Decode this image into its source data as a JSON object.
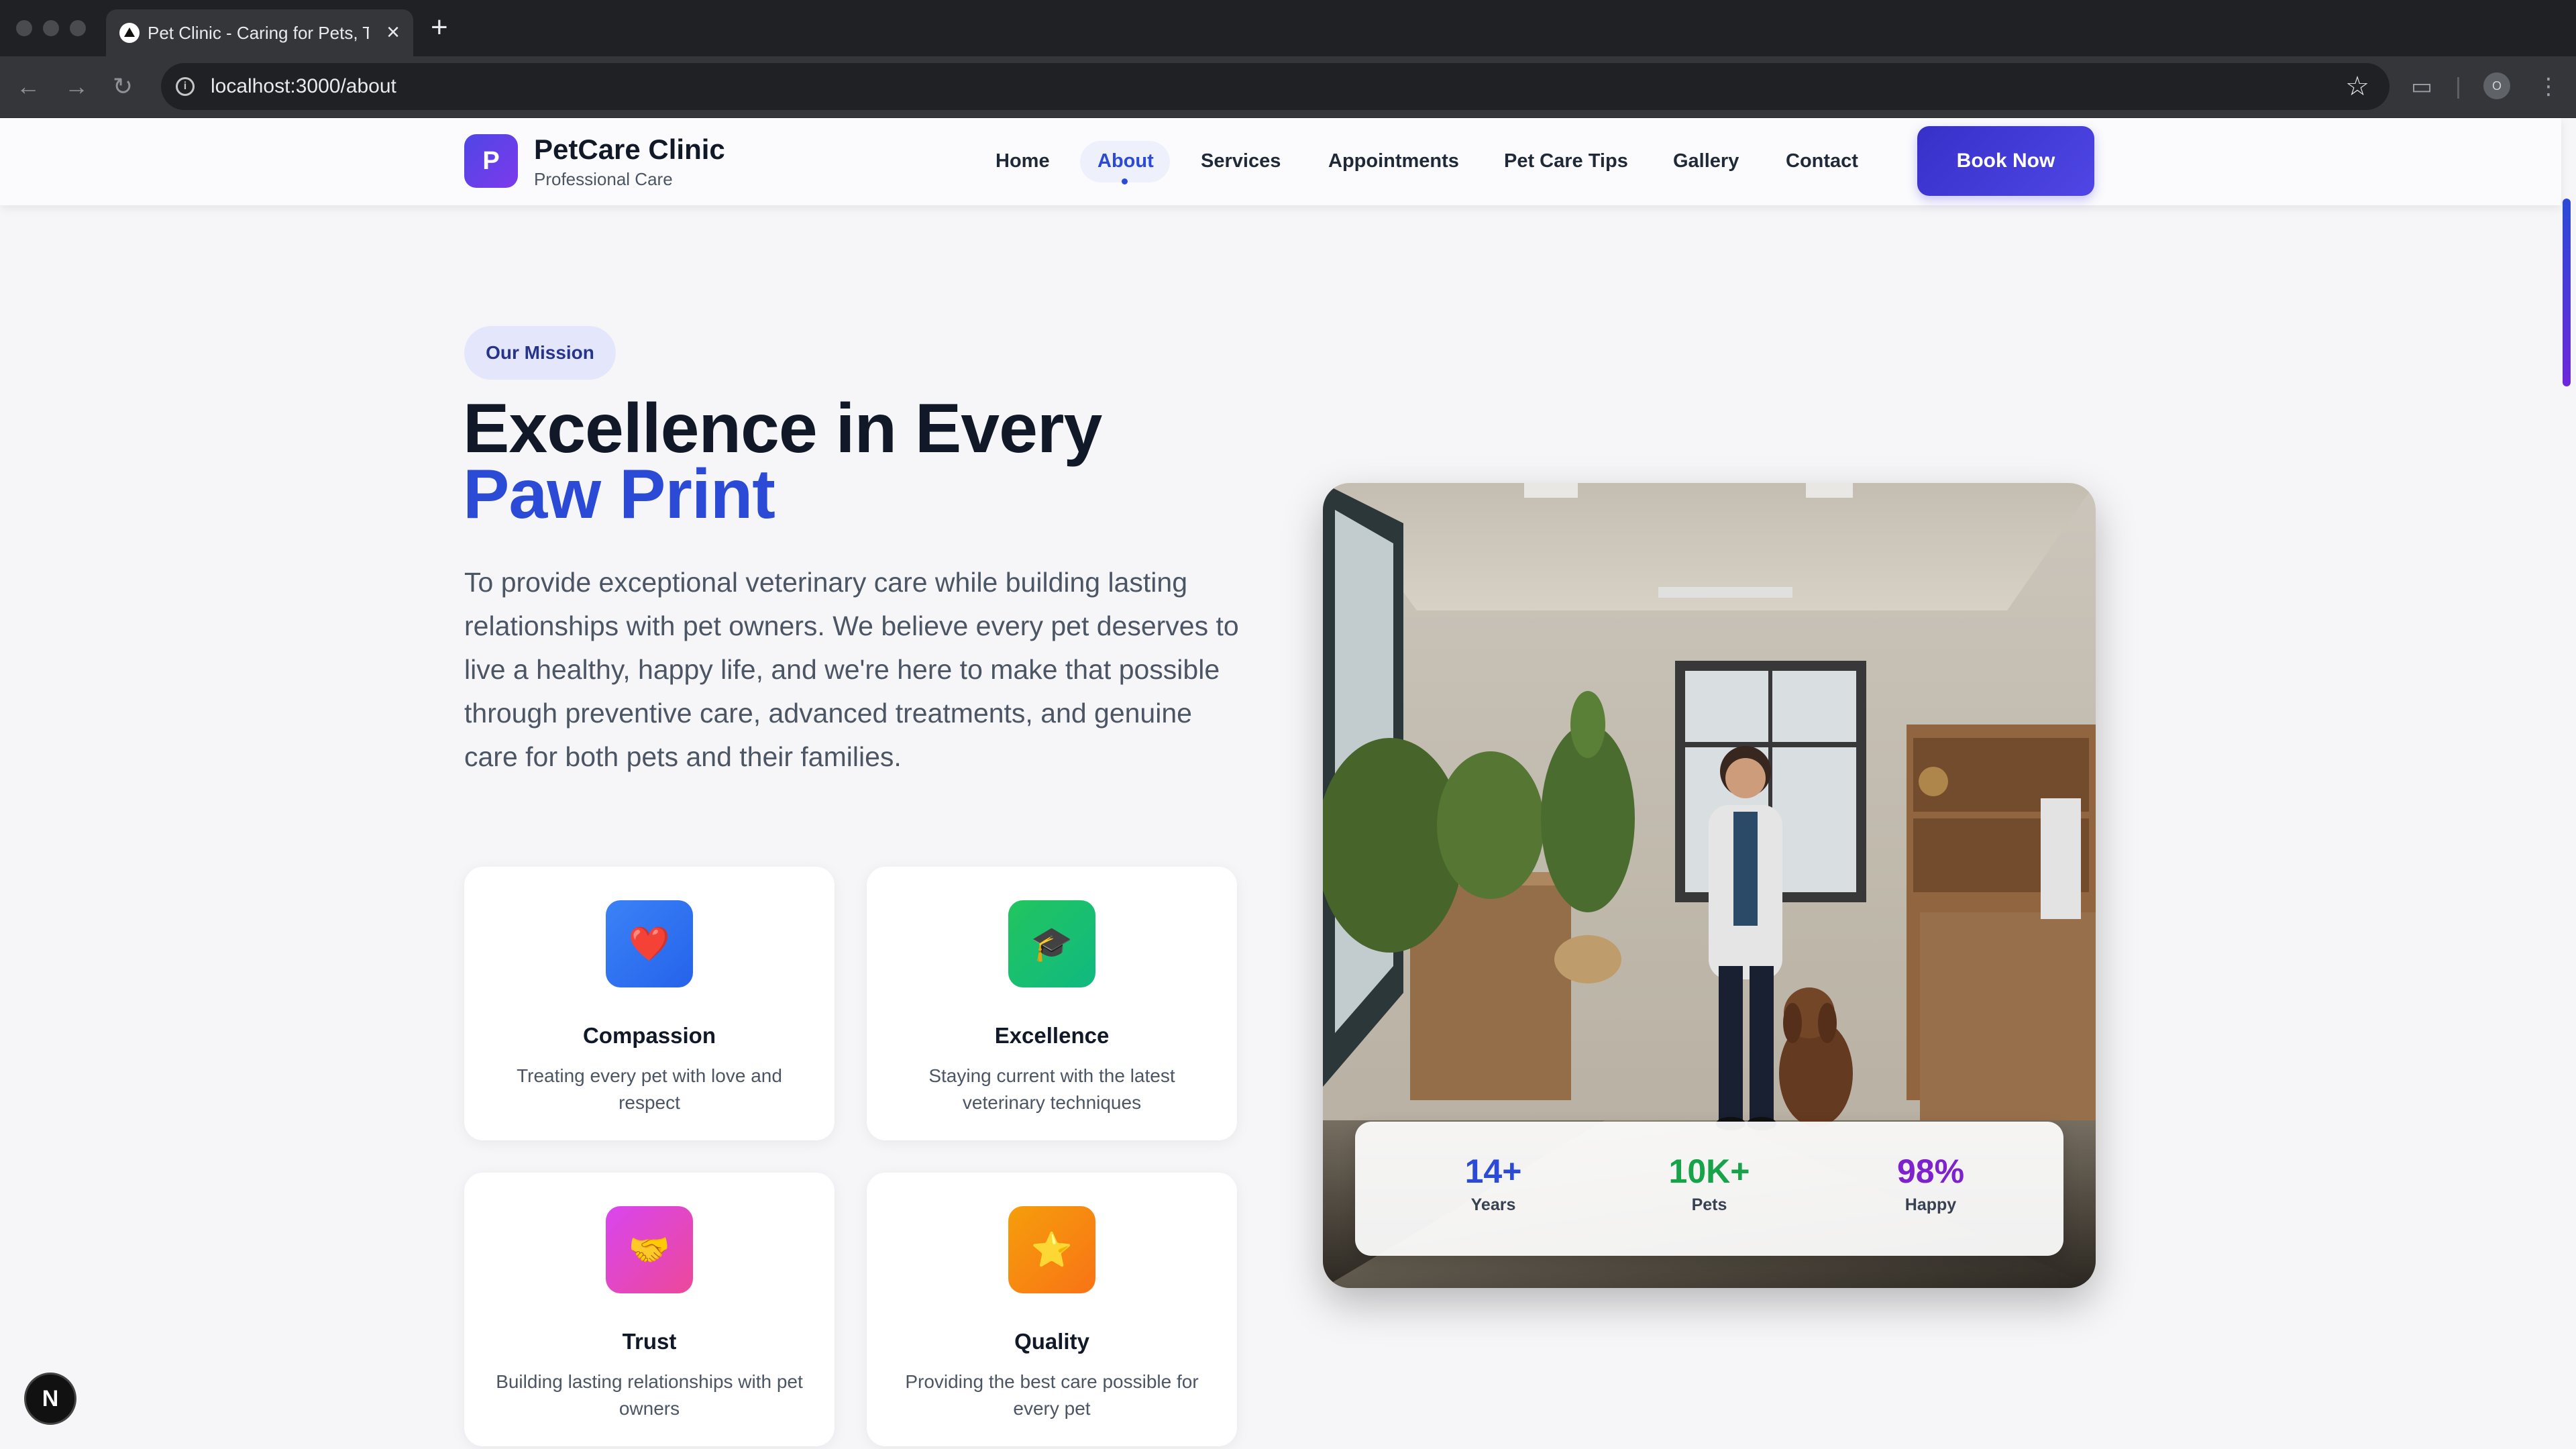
{
  "browser": {
    "tab_title": "Pet Clinic - Caring for Pets, Tr",
    "url": "localhost:3000/about",
    "profile_initial": "O"
  },
  "site": {
    "logo_letter": "P",
    "name": "PetCare Clinic",
    "tagline": "Professional Care",
    "nav": [
      "Home",
      "About",
      "Services",
      "Appointments",
      "Pet Care Tips",
      "Gallery",
      "Contact"
    ],
    "active_nav": "About",
    "cta": "Book Now"
  },
  "mission": {
    "pill": "Our Mission",
    "heading_line1": "Excellence in Every",
    "heading_line2": "Paw Print",
    "paragraph": "To provide exceptional veterinary care while building lasting relationships with pet owners. We believe every pet deserves to live a healthy, happy life, and we're here to make that possible through preventive care, advanced treatments, and genuine care for both pets and their families."
  },
  "values": [
    {
      "title": "Compassion",
      "desc": "Treating every pet with love and respect",
      "icon": "heart-icon",
      "glyph": "❤️"
    },
    {
      "title": "Excellence",
      "desc": "Staying current with the latest veterinary techniques",
      "icon": "graduation-cap-icon",
      "glyph": "🎓"
    },
    {
      "title": "Trust",
      "desc": "Building lasting relationships with pet owners",
      "icon": "handshake-icon",
      "glyph": "🤝"
    },
    {
      "title": "Quality",
      "desc": "Providing the best care possible for every pet",
      "icon": "star-icon",
      "glyph": "⭐"
    }
  ],
  "stats": [
    {
      "value": "14+",
      "label": "Years",
      "color": "#2b4bd7"
    },
    {
      "value": "10K+",
      "label": "Pets",
      "color": "#16a34a"
    },
    {
      "value": "98%",
      "label": "Happy",
      "color": "#7e22ce"
    }
  ],
  "colors": {
    "brand": "#4f46e5",
    "accent": "#2b4bd7"
  },
  "dev_badge": "N"
}
